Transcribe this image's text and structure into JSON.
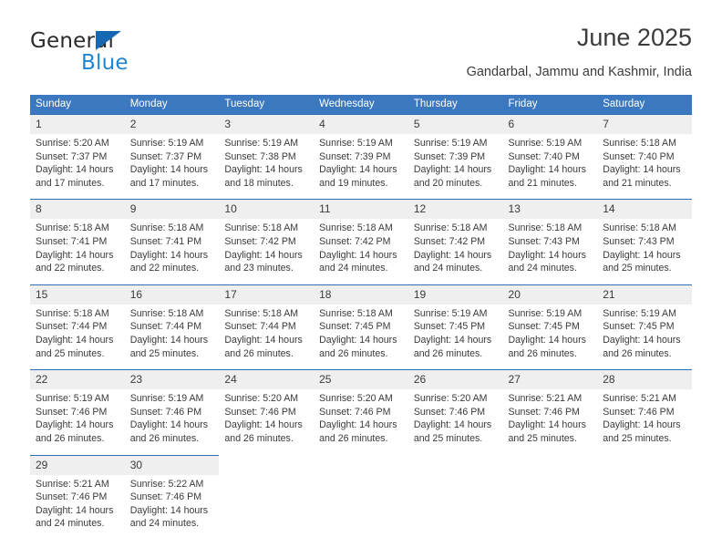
{
  "brand": {
    "name_part1": "General",
    "name_part2": "Blue",
    "triangle_color": "#1668b3",
    "blue_color": "#1f85d0"
  },
  "header": {
    "title": "June 2025",
    "subtitle": "Gandarbal, Jammu and Kashmir, India"
  },
  "calendar": {
    "header_bg": "#3b78bf",
    "daynum_bg": "#efefef",
    "rule_color": "#2f6cb0",
    "weekdays": [
      "Sunday",
      "Monday",
      "Tuesday",
      "Wednesday",
      "Thursday",
      "Friday",
      "Saturday"
    ],
    "weeks": [
      {
        "days": [
          {
            "num": "1",
            "sunrise": "Sunrise: 5:20 AM",
            "sunset": "Sunset: 7:37 PM",
            "daylight1": "Daylight: 14 hours",
            "daylight2": "and 17 minutes."
          },
          {
            "num": "2",
            "sunrise": "Sunrise: 5:19 AM",
            "sunset": "Sunset: 7:37 PM",
            "daylight1": "Daylight: 14 hours",
            "daylight2": "and 17 minutes."
          },
          {
            "num": "3",
            "sunrise": "Sunrise: 5:19 AM",
            "sunset": "Sunset: 7:38 PM",
            "daylight1": "Daylight: 14 hours",
            "daylight2": "and 18 minutes."
          },
          {
            "num": "4",
            "sunrise": "Sunrise: 5:19 AM",
            "sunset": "Sunset: 7:39 PM",
            "daylight1": "Daylight: 14 hours",
            "daylight2": "and 19 minutes."
          },
          {
            "num": "5",
            "sunrise": "Sunrise: 5:19 AM",
            "sunset": "Sunset: 7:39 PM",
            "daylight1": "Daylight: 14 hours",
            "daylight2": "and 20 minutes."
          },
          {
            "num": "6",
            "sunrise": "Sunrise: 5:19 AM",
            "sunset": "Sunset: 7:40 PM",
            "daylight1": "Daylight: 14 hours",
            "daylight2": "and 21 minutes."
          },
          {
            "num": "7",
            "sunrise": "Sunrise: 5:18 AM",
            "sunset": "Sunset: 7:40 PM",
            "daylight1": "Daylight: 14 hours",
            "daylight2": "and 21 minutes."
          }
        ]
      },
      {
        "days": [
          {
            "num": "8",
            "sunrise": "Sunrise: 5:18 AM",
            "sunset": "Sunset: 7:41 PM",
            "daylight1": "Daylight: 14 hours",
            "daylight2": "and 22 minutes."
          },
          {
            "num": "9",
            "sunrise": "Sunrise: 5:18 AM",
            "sunset": "Sunset: 7:41 PM",
            "daylight1": "Daylight: 14 hours",
            "daylight2": "and 22 minutes."
          },
          {
            "num": "10",
            "sunrise": "Sunrise: 5:18 AM",
            "sunset": "Sunset: 7:42 PM",
            "daylight1": "Daylight: 14 hours",
            "daylight2": "and 23 minutes."
          },
          {
            "num": "11",
            "sunrise": "Sunrise: 5:18 AM",
            "sunset": "Sunset: 7:42 PM",
            "daylight1": "Daylight: 14 hours",
            "daylight2": "and 24 minutes."
          },
          {
            "num": "12",
            "sunrise": "Sunrise: 5:18 AM",
            "sunset": "Sunset: 7:42 PM",
            "daylight1": "Daylight: 14 hours",
            "daylight2": "and 24 minutes."
          },
          {
            "num": "13",
            "sunrise": "Sunrise: 5:18 AM",
            "sunset": "Sunset: 7:43 PM",
            "daylight1": "Daylight: 14 hours",
            "daylight2": "and 24 minutes."
          },
          {
            "num": "14",
            "sunrise": "Sunrise: 5:18 AM",
            "sunset": "Sunset: 7:43 PM",
            "daylight1": "Daylight: 14 hours",
            "daylight2": "and 25 minutes."
          }
        ]
      },
      {
        "days": [
          {
            "num": "15",
            "sunrise": "Sunrise: 5:18 AM",
            "sunset": "Sunset: 7:44 PM",
            "daylight1": "Daylight: 14 hours",
            "daylight2": "and 25 minutes."
          },
          {
            "num": "16",
            "sunrise": "Sunrise: 5:18 AM",
            "sunset": "Sunset: 7:44 PM",
            "daylight1": "Daylight: 14 hours",
            "daylight2": "and 25 minutes."
          },
          {
            "num": "17",
            "sunrise": "Sunrise: 5:18 AM",
            "sunset": "Sunset: 7:44 PM",
            "daylight1": "Daylight: 14 hours",
            "daylight2": "and 26 minutes."
          },
          {
            "num": "18",
            "sunrise": "Sunrise: 5:18 AM",
            "sunset": "Sunset: 7:45 PM",
            "daylight1": "Daylight: 14 hours",
            "daylight2": "and 26 minutes."
          },
          {
            "num": "19",
            "sunrise": "Sunrise: 5:19 AM",
            "sunset": "Sunset: 7:45 PM",
            "daylight1": "Daylight: 14 hours",
            "daylight2": "and 26 minutes."
          },
          {
            "num": "20",
            "sunrise": "Sunrise: 5:19 AM",
            "sunset": "Sunset: 7:45 PM",
            "daylight1": "Daylight: 14 hours",
            "daylight2": "and 26 minutes."
          },
          {
            "num": "21",
            "sunrise": "Sunrise: 5:19 AM",
            "sunset": "Sunset: 7:45 PM",
            "daylight1": "Daylight: 14 hours",
            "daylight2": "and 26 minutes."
          }
        ]
      },
      {
        "days": [
          {
            "num": "22",
            "sunrise": "Sunrise: 5:19 AM",
            "sunset": "Sunset: 7:46 PM",
            "daylight1": "Daylight: 14 hours",
            "daylight2": "and 26 minutes."
          },
          {
            "num": "23",
            "sunrise": "Sunrise: 5:19 AM",
            "sunset": "Sunset: 7:46 PM",
            "daylight1": "Daylight: 14 hours",
            "daylight2": "and 26 minutes."
          },
          {
            "num": "24",
            "sunrise": "Sunrise: 5:20 AM",
            "sunset": "Sunset: 7:46 PM",
            "daylight1": "Daylight: 14 hours",
            "daylight2": "and 26 minutes."
          },
          {
            "num": "25",
            "sunrise": "Sunrise: 5:20 AM",
            "sunset": "Sunset: 7:46 PM",
            "daylight1": "Daylight: 14 hours",
            "daylight2": "and 26 minutes."
          },
          {
            "num": "26",
            "sunrise": "Sunrise: 5:20 AM",
            "sunset": "Sunset: 7:46 PM",
            "daylight1": "Daylight: 14 hours",
            "daylight2": "and 25 minutes."
          },
          {
            "num": "27",
            "sunrise": "Sunrise: 5:21 AM",
            "sunset": "Sunset: 7:46 PM",
            "daylight1": "Daylight: 14 hours",
            "daylight2": "and 25 minutes."
          },
          {
            "num": "28",
            "sunrise": "Sunrise: 5:21 AM",
            "sunset": "Sunset: 7:46 PM",
            "daylight1": "Daylight: 14 hours",
            "daylight2": "and 25 minutes."
          }
        ]
      },
      {
        "days": [
          {
            "num": "29",
            "sunrise": "Sunrise: 5:21 AM",
            "sunset": "Sunset: 7:46 PM",
            "daylight1": "Daylight: 14 hours",
            "daylight2": "and 24 minutes."
          },
          {
            "num": "30",
            "sunrise": "Sunrise: 5:22 AM",
            "sunset": "Sunset: 7:46 PM",
            "daylight1": "Daylight: 14 hours",
            "daylight2": "and 24 minutes."
          },
          {
            "num": "",
            "sunrise": "",
            "sunset": "",
            "daylight1": "",
            "daylight2": ""
          },
          {
            "num": "",
            "sunrise": "",
            "sunset": "",
            "daylight1": "",
            "daylight2": ""
          },
          {
            "num": "",
            "sunrise": "",
            "sunset": "",
            "daylight1": "",
            "daylight2": ""
          },
          {
            "num": "",
            "sunrise": "",
            "sunset": "",
            "daylight1": "",
            "daylight2": ""
          },
          {
            "num": "",
            "sunrise": "",
            "sunset": "",
            "daylight1": "",
            "daylight2": ""
          }
        ]
      }
    ]
  }
}
